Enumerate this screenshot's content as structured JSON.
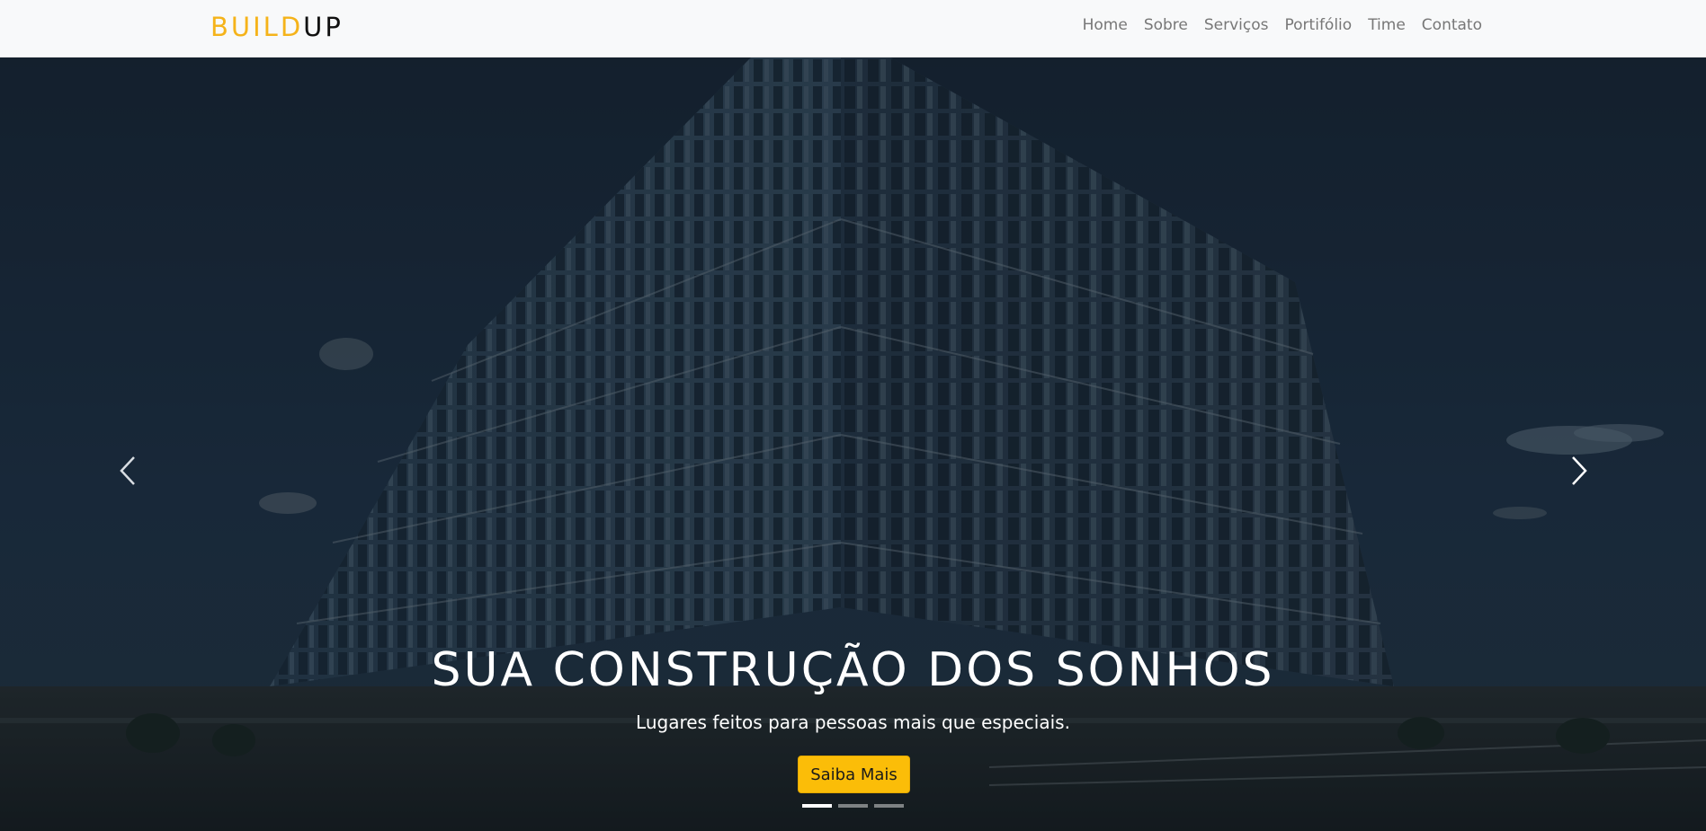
{
  "navbar": {
    "brand_part1": "BUILD",
    "brand_part2": "UP",
    "links": [
      {
        "label": "Home"
      },
      {
        "label": "Sobre"
      },
      {
        "label": "Serviços"
      },
      {
        "label": "Portifólio"
      },
      {
        "label": "Time"
      },
      {
        "label": "Contato"
      }
    ]
  },
  "hero": {
    "title": "SUA CONSTRUÇÃO DOS SONHOS",
    "subtitle": "Lugares feitos para pessoas mais que especiais.",
    "cta_label": "Saiba Mais",
    "slide_count": 3,
    "active_slide": 1,
    "prev_icon": "chevron-left-icon",
    "next_icon": "chevron-right-icon"
  },
  "colors": {
    "brand_accent": "#f5b31a",
    "cta_bg": "#fbbd08",
    "navbar_bg": "#f8f9fa"
  }
}
